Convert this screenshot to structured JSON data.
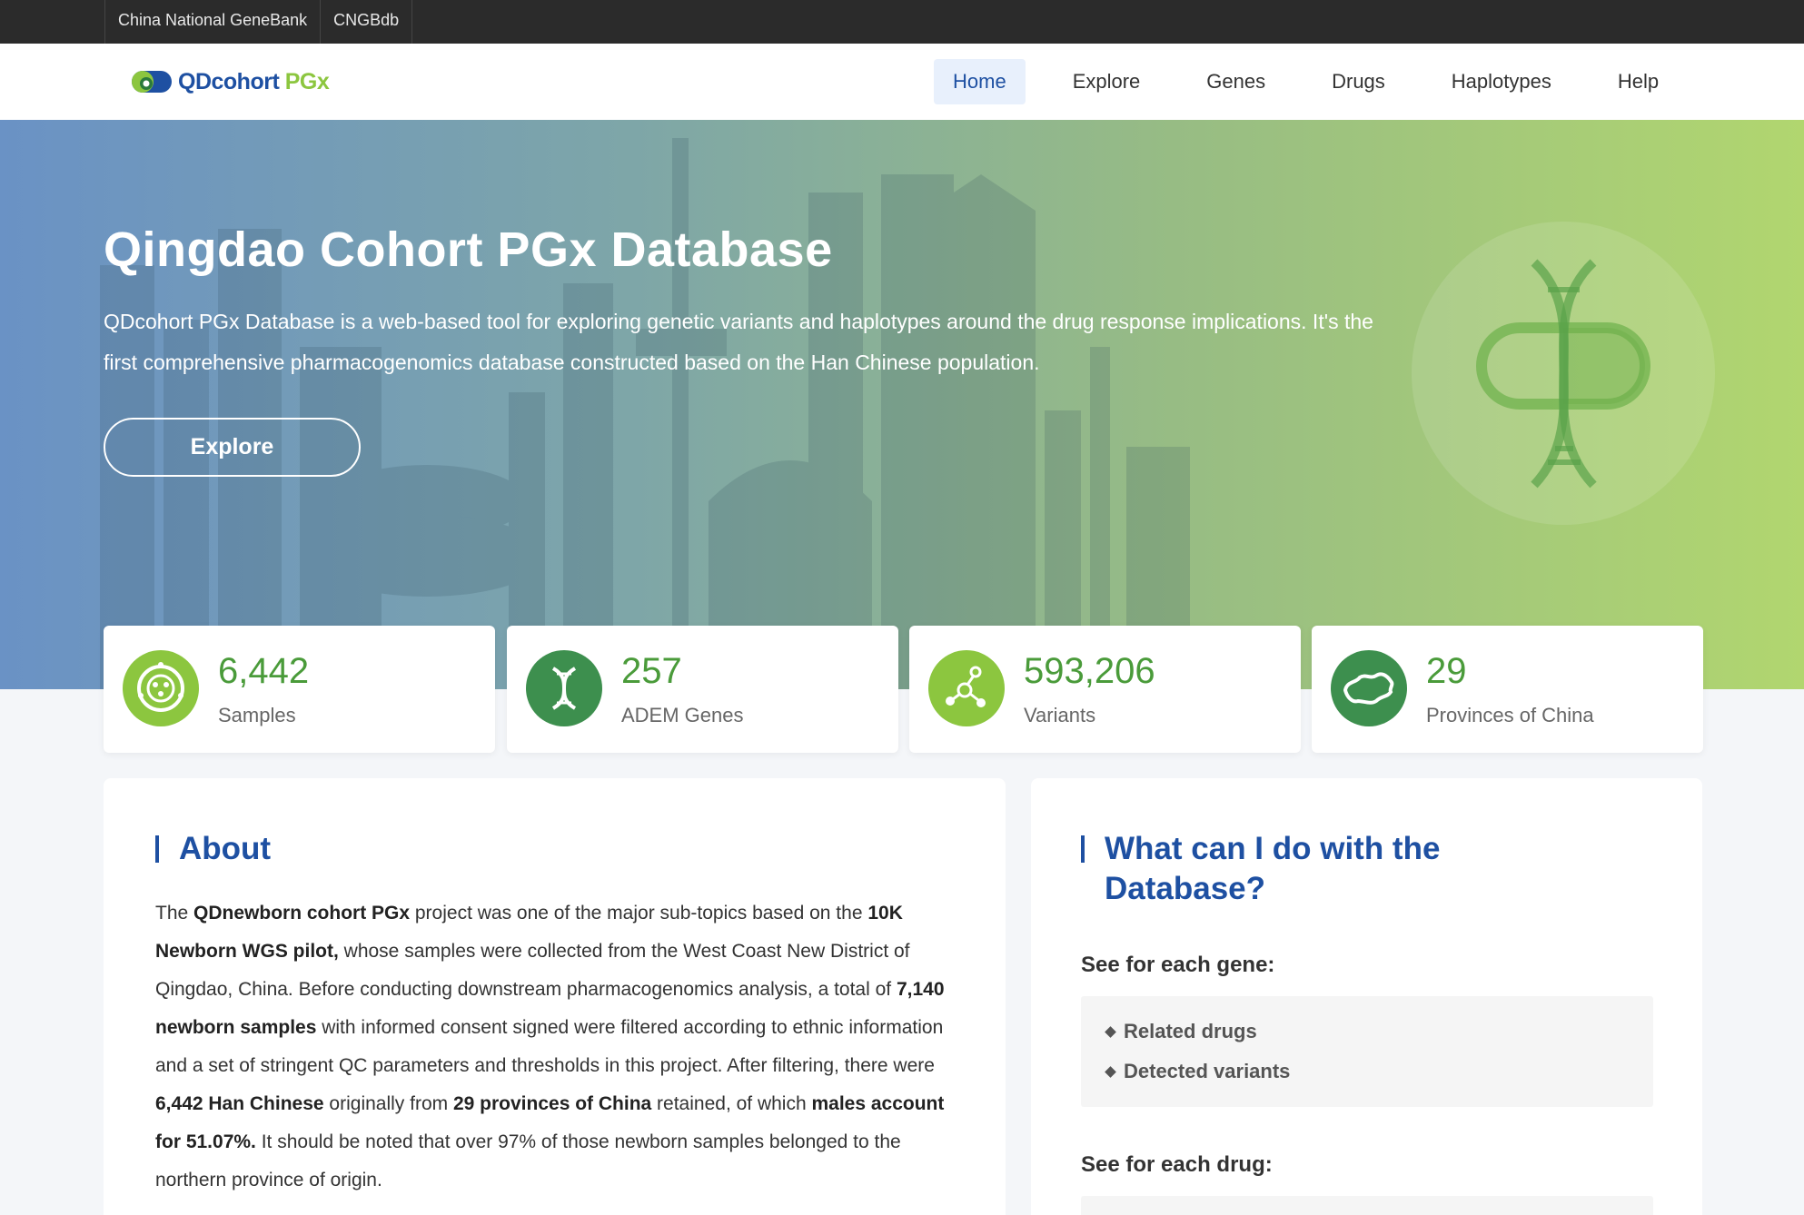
{
  "topbar": {
    "links": [
      "China National GeneBank",
      "CNGBdb"
    ]
  },
  "header": {
    "logo": {
      "q": "QDcohort",
      "pgx": "PGx"
    },
    "nav": [
      "Home",
      "Explore",
      "Genes",
      "Drugs",
      "Haplotypes",
      "Help"
    ],
    "active": "Home"
  },
  "hero": {
    "title": "Qingdao Cohort PGx Database",
    "description": "QDcohort PGx Database is a web-based tool for exploring genetic variants and haplotypes around the drug response implications. It's the first comprehensive pharmacogenomics database constructed based on the Han Chinese population.",
    "button": "Explore"
  },
  "stats": [
    {
      "value": "6,442",
      "label": "Samples",
      "color": "#8cc63f",
      "icon": "sample-icon"
    },
    {
      "value": "257",
      "label": "ADEM Genes",
      "color": "#3d8f4e",
      "icon": "dna-icon"
    },
    {
      "value": "593,206",
      "label": "Variants",
      "color": "#8cc63f",
      "icon": "molecule-icon"
    },
    {
      "value": "29",
      "label": "Provinces of China",
      "color": "#3d8f4e",
      "icon": "china-map-icon"
    }
  ],
  "about": {
    "title": "About",
    "paragraph": [
      {
        "t": "The ",
        "b": false
      },
      {
        "t": "QDnewborn cohort PGx",
        "b": true
      },
      {
        "t": " project was one of the major sub-topics based on the ",
        "b": false
      },
      {
        "t": "10K Newborn WGS pilot,",
        "b": true
      },
      {
        "t": " whose samples were collected from the West Coast New District of Qingdao, China. Before conducting downstream pharmacogenomics analysis, a total of ",
        "b": false
      },
      {
        "t": "7,140 newborn samples",
        "b": true
      },
      {
        "t": " with informed consent signed were filtered according to ethnic information and a set of stringent QC parameters and thresholds in this project. After filtering, there were ",
        "b": false
      },
      {
        "t": "6,442 Han Chinese",
        "b": true
      },
      {
        "t": " originally from ",
        "b": false
      },
      {
        "t": "29 provinces of China",
        "b": true
      },
      {
        "t": " retained, of which ",
        "b": false
      },
      {
        "t": "males account for 51.07%.",
        "b": true
      },
      {
        "t": " It should be noted that over 97% of those newborn samples belonged to the northern province of origin.",
        "b": false
      }
    ]
  },
  "what": {
    "title": "What can I do with the Database?",
    "gene_heading": "See for each gene:",
    "gene_items": [
      "Related drugs",
      "Detected variants"
    ],
    "drug_heading": "See for each drug:"
  }
}
